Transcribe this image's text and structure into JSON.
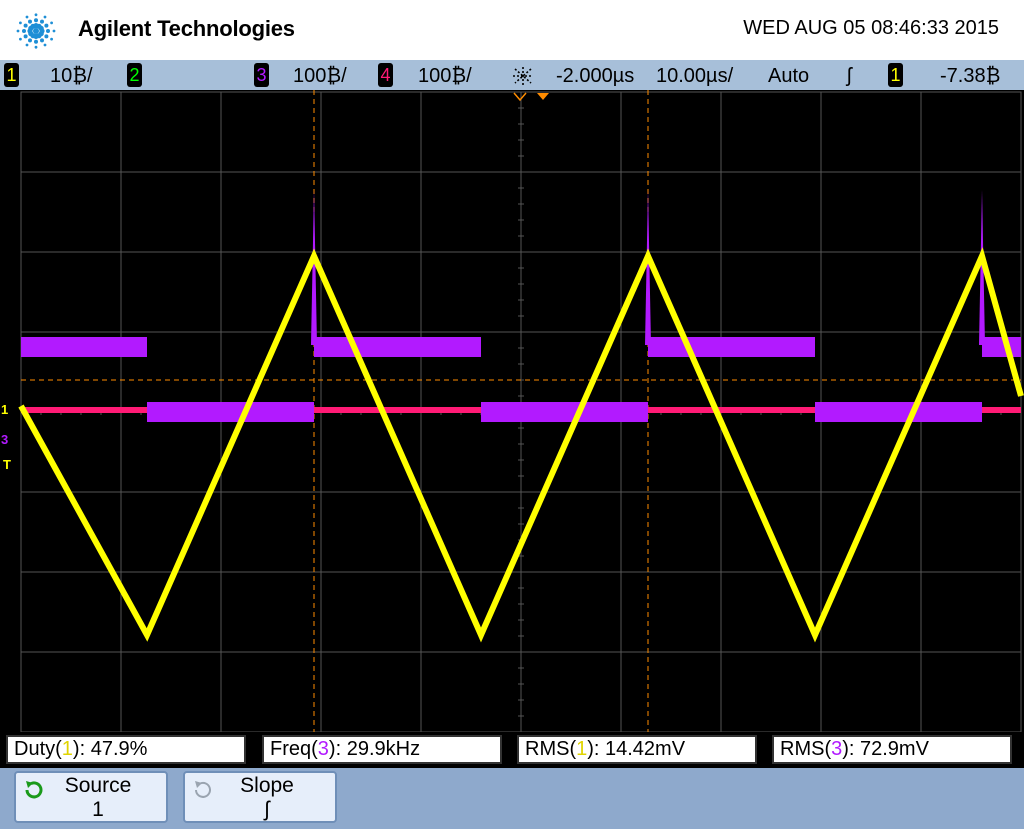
{
  "header": {
    "brand": "Agilent Technologies",
    "datetime": "WED AUG 05 08:46:33 2015"
  },
  "status": {
    "ch1_num": "1",
    "ch1_scale": "10₿/",
    "ch2_num": "2",
    "ch3_num": "3",
    "ch3_scale": "100₿/",
    "ch4_num": "4",
    "ch4_scale": "100₿/",
    "delay": "-2.000µs",
    "timebase": "10.00µs/",
    "trigger_mode": "Auto",
    "trigger_slope": "ʃ",
    "trigger_source": "1",
    "trigger_level": "-7.38₿"
  },
  "markers": {
    "ch1": "1",
    "ch3": "3",
    "trigger": "T"
  },
  "measurements": [
    {
      "prefix": "Duty(",
      "channel": "1",
      "suffix": "): 47.9%",
      "color": "#ffff00"
    },
    {
      "prefix": "Freq(",
      "channel": "3",
      "suffix": "): 29.9kHz",
      "color": "#b21aff"
    },
    {
      "prefix": "RMS(",
      "channel": "1",
      "suffix": "): 14.42mV",
      "color": "#ffff00"
    },
    {
      "prefix": "RMS(",
      "channel": "3",
      "suffix": "): 72.9mV",
      "color": "#b21aff"
    }
  ],
  "softkeys": {
    "source_label": "Source",
    "source_value": "1",
    "slope_label": "Slope",
    "slope_value": "ʃ"
  },
  "colors": {
    "ch1": "#ffff00",
    "ch2": "#00ff00",
    "ch3": "#b21aff",
    "ch4": "#ff1a75",
    "trigger_marker": "#ff8c00",
    "grid": "#555555"
  }
}
